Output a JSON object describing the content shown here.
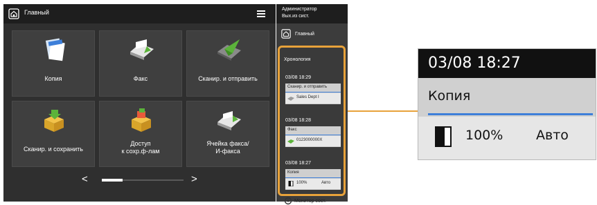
{
  "header": {
    "title": "Главный",
    "menu_icon": "hamburger-icon",
    "home_icon": "home-icon"
  },
  "tiles": [
    {
      "label": "Копия",
      "icon": "copy-icon"
    },
    {
      "label": "Факс",
      "icon": "fax-icon"
    },
    {
      "label": "Сканир. и отправить",
      "icon": "scan-send-icon"
    },
    {
      "label": "Сканир. и сохранить",
      "icon": "scan-save-icon"
    },
    {
      "label_line1": "Доступ",
      "label_line2": "к сохр.ф-лам",
      "icon": "access-files-icon"
    },
    {
      "label_line1": "Ячейка факса/",
      "label_line2": "И-факса",
      "icon": "fax-inbox-icon"
    }
  ],
  "pager": {
    "prev": "<",
    "next": ">"
  },
  "side": {
    "admin_line1": "Администратор",
    "admin_line2": "Вых.из сист.",
    "home_label": "Главный",
    "history_title": "Хронология",
    "history": [
      {
        "time": "03/08 18:29",
        "name": "Сканир. и отправить",
        "detail": "Sales Dept I",
        "icon": "scan-send-icon"
      },
      {
        "time": "03/08 18:28",
        "name": "Факс",
        "detail": "0123000000X",
        "icon": "fax-icon"
      },
      {
        "time": "03/08 18:27",
        "name": "Копия",
        "detail": "100%",
        "mode": "Авто",
        "icon": "copy-page-icon"
      }
    ],
    "monitor_label": "Монитор сост."
  },
  "zoom": {
    "time": "03/08 18:27",
    "name": "Копия",
    "percent": "100%",
    "mode": "Авто"
  },
  "colors": {
    "accent": "#e8a23a",
    "blue_line": "#3d7fd9",
    "screen_bg": "#2f2f2f"
  }
}
